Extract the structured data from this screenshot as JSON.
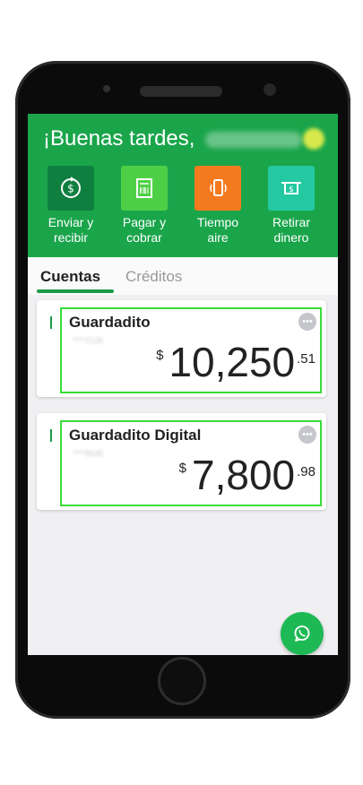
{
  "header": {
    "greeting": "¡Buenas tardes,",
    "actions": [
      {
        "label_line1": "Enviar y",
        "label_line2": "recibir",
        "icon": "send-receive-icon"
      },
      {
        "label_line1": "Pagar y",
        "label_line2": "cobrar",
        "icon": "pay-collect-icon"
      },
      {
        "label_line1": "Tiempo",
        "label_line2": "aire",
        "icon": "phone-airtime-icon"
      },
      {
        "label_line1": "Retirar",
        "label_line2": "dinero",
        "icon": "withdraw-cash-icon"
      }
    ]
  },
  "tabs": [
    {
      "label": "Cuentas",
      "active": true
    },
    {
      "label": "Créditos",
      "active": false
    }
  ],
  "accounts": [
    {
      "name": "Guardadito",
      "number_masked": "****2126",
      "currency": "$",
      "amount_int": "10,250",
      "amount_dec": ".51"
    },
    {
      "name": "Guardadito Digital",
      "number_masked": "****9636",
      "currency": "$",
      "amount_int": "7,800",
      "amount_dec": ".98"
    }
  ],
  "colors": {
    "brand_green": "#1aa54b",
    "tab_green": "#1a9b48",
    "highlight_outline": "#37dd37",
    "orange": "#f47a1f",
    "teal": "#24c9a1"
  },
  "fab": {
    "icon": "whatsapp-icon"
  }
}
